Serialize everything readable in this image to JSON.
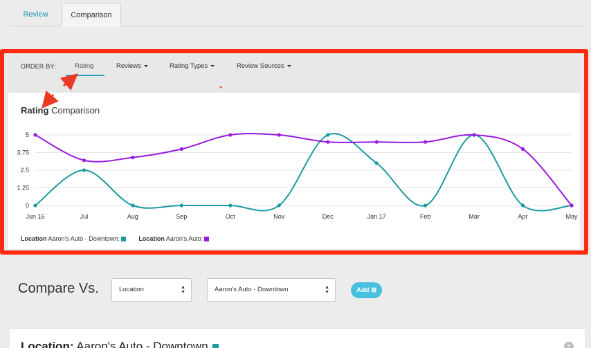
{
  "tabs": [
    {
      "label": "Review"
    },
    {
      "label": "Comparison"
    }
  ],
  "order_bar": {
    "label": "ORDER BY:",
    "items": [
      {
        "label": "Rating",
        "active": true
      },
      {
        "label": "Reviews"
      },
      {
        "label": "Rating Types"
      },
      {
        "label": "Review Sources"
      }
    ]
  },
  "chart": {
    "title_bold": "Rating",
    "title_rest": " Comparison"
  },
  "chart_data": {
    "type": "line",
    "categories": [
      "Jun 16",
      "Jul",
      "Aug",
      "Sep",
      "Oct",
      "Nov",
      "Dec",
      "Jan 17",
      "Feb",
      "Mar",
      "Apr",
      "May"
    ],
    "y_ticks": [
      "0",
      "1.25",
      "2.5",
      "3.75",
      "5"
    ],
    "ylim": [
      0,
      5
    ],
    "grid": true,
    "smooth": true,
    "legend_position": "bottom-left",
    "series": [
      {
        "name": "Aaron's Auto - Downtown:",
        "legend_prefix": "Location",
        "color": "#1b9aa0",
        "values": [
          0,
          2.5,
          0,
          0,
          0,
          0,
          5,
          3,
          0,
          5,
          0,
          0
        ]
      },
      {
        "name": "Aaron's Auto:",
        "legend_prefix": "Location",
        "color": "#9b19e0",
        "values": [
          5,
          3.2,
          3.4,
          4,
          5,
          5,
          4.5,
          4.5,
          4.5,
          5,
          4,
          0
        ]
      }
    ]
  },
  "compare": {
    "label": "Compare Vs.",
    "select_type": "Location",
    "select_target": "Aaron's Auto - Downtown",
    "add_label": "Add"
  },
  "bottom_card": {
    "prefix": "Location:",
    "name": "Aaron's Auto - Downtown",
    "color": "#1b9aa0"
  },
  "icons": {
    "caret": "caret-down-icon",
    "updown": "select-updown-icon",
    "add": "add-icon",
    "close": "close-icon"
  }
}
